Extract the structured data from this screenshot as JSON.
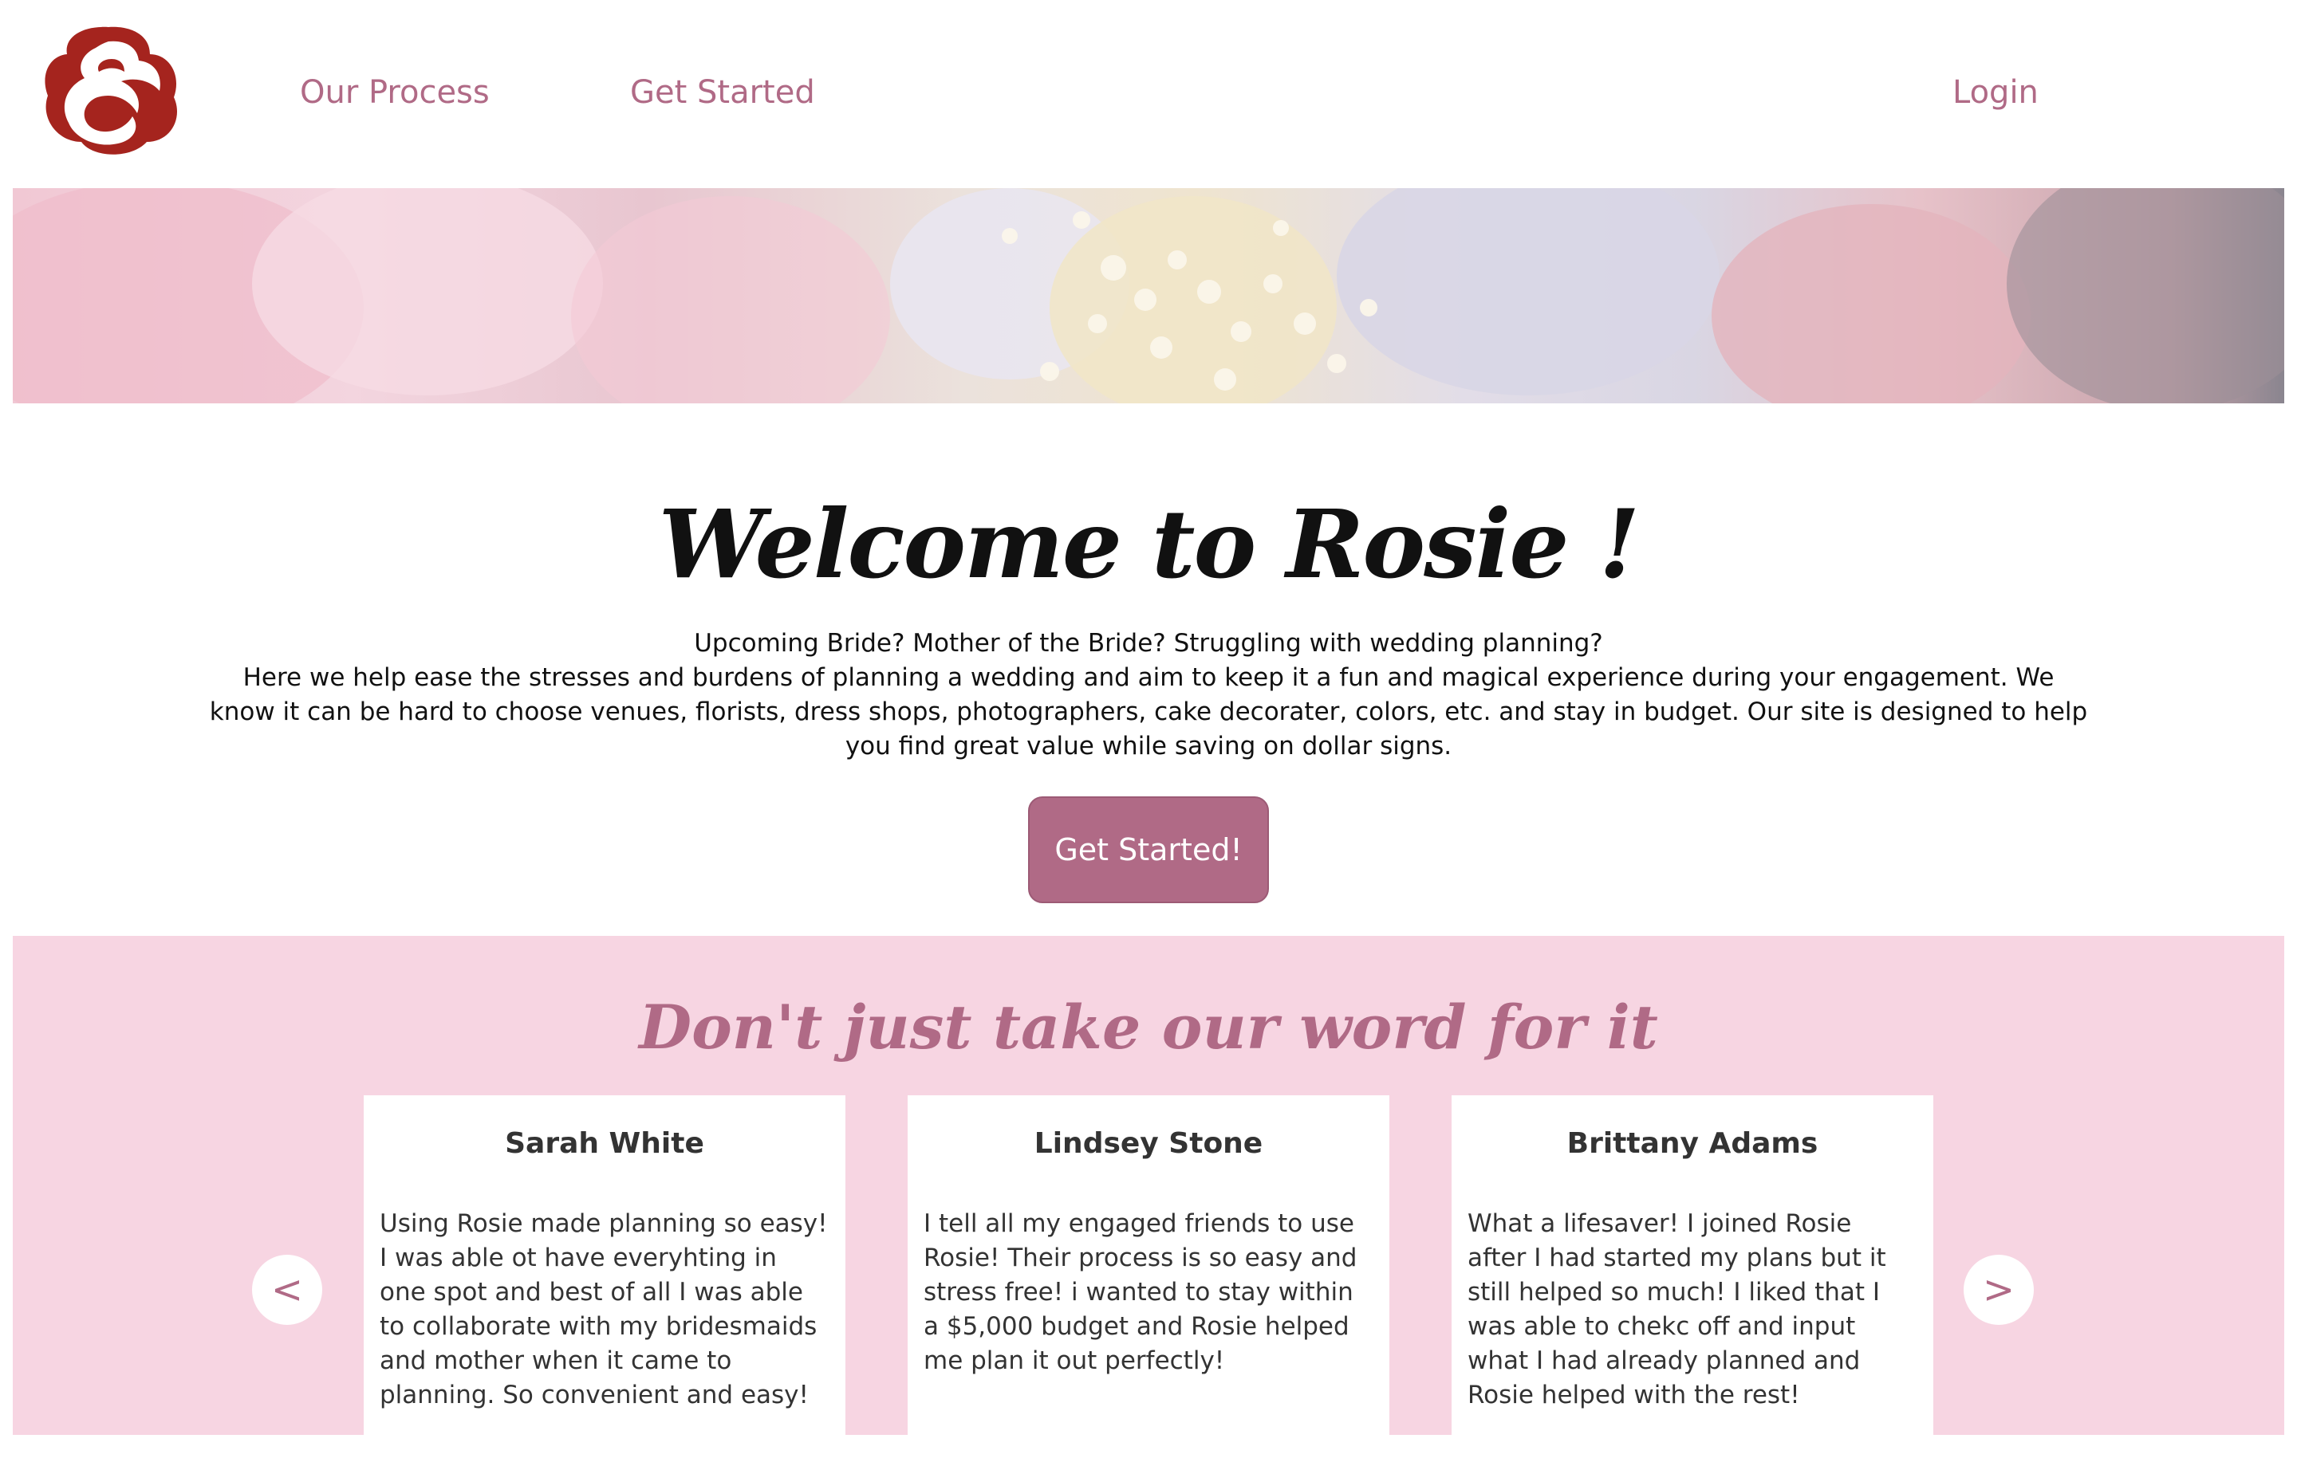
{
  "nav": {
    "process_label": "Our Process",
    "start_label": "Get Started",
    "login_label": "Login"
  },
  "welcome": {
    "title": "Welcome to Rosie !",
    "intro_line1": "Upcoming Bride? Mother of the Bride? Struggling with wedding planning?",
    "intro_line2": "Here we help ease the stresses and burdens of planning a wedding and aim to keep it a fun and magical experience during your engagement. We know it can be hard to choose venues, florists, dress shops, photographers, cake decorater, colors, etc. and stay in budget. Our site is designed to help you find great value while saving on dollar signs.",
    "cta_label": "Get Started!"
  },
  "testimonials": {
    "title": "Don't just take our word for it",
    "prev_label": "<",
    "next_label": ">",
    "items": [
      {
        "name": "Sarah White",
        "text": "Using Rosie made planning so easy! I was able ot have everyhting in one spot and best of all I was able to collaborate with my bridesmaids and mother when it came to planning. So convenient and easy!"
      },
      {
        "name": "Lindsey Stone",
        "text": "I tell all my engaged friends to use Rosie! Their process is so easy and stress free! i wanted to stay within a $5,000 budget and Rosie helped me plan it out perfectly!"
      },
      {
        "name": "Brittany Adams",
        "text": "What a lifesaver! I joined Rosie after I had started my plans but it still helped so much! I liked that I was able to chekc off and input what I had already planned and Rosie helped with the rest!"
      }
    ]
  },
  "colors": {
    "accent": "#b06a86",
    "logo": "#a5241e",
    "testimonial_bg": "#f7d5e2"
  },
  "icons": {
    "logo": "rose-icon",
    "prev": "chevron-left-icon",
    "next": "chevron-right-icon"
  }
}
